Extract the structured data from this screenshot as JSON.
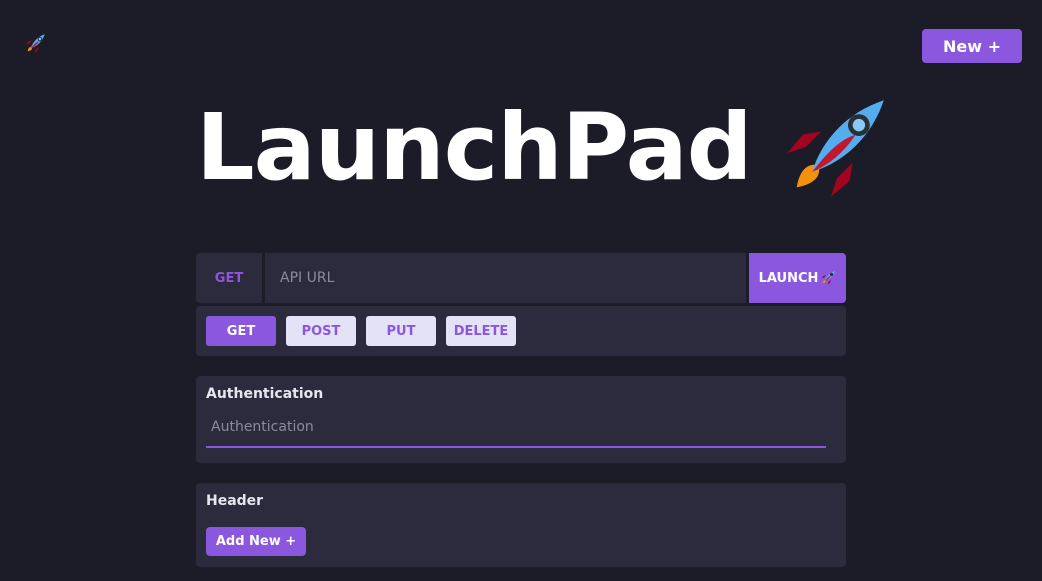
{
  "app": {
    "logo_icon": "rocket-icon",
    "new_button_label": "New +"
  },
  "hero": {
    "title": "LaunchPad",
    "icon": "rocket-icon"
  },
  "request": {
    "method_badge": "GET",
    "url_placeholder": "API URL",
    "url_value": "",
    "launch_label": "LAUNCH",
    "launch_icon": "rocket-icon"
  },
  "methods": [
    {
      "label": "GET",
      "active": true
    },
    {
      "label": "POST",
      "active": false
    },
    {
      "label": "PUT",
      "active": false
    },
    {
      "label": "DELETE",
      "active": false
    }
  ],
  "authentication": {
    "title": "Authentication",
    "placeholder": "Authentication",
    "value": ""
  },
  "header": {
    "title": "Header",
    "add_label": "Add New +"
  },
  "colors": {
    "background": "#1c1b28",
    "panel": "#2c2b3e",
    "accent": "#8c57df",
    "inactive_button": "#e4e2f7"
  }
}
